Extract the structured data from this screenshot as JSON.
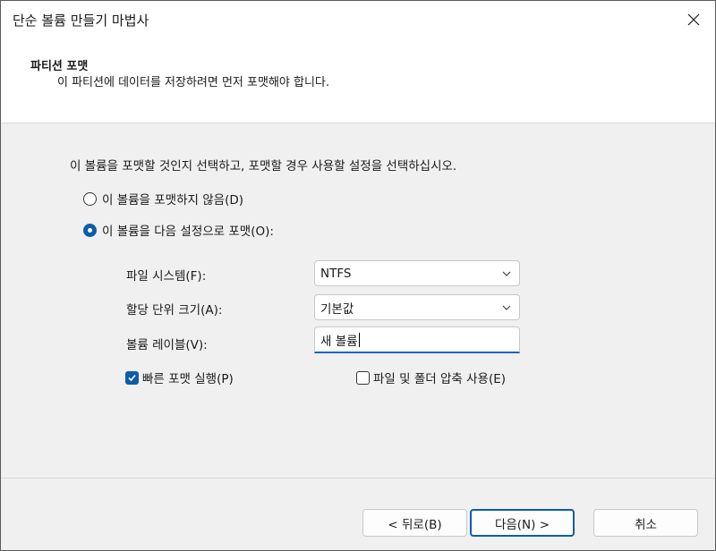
{
  "window": {
    "title": "단순 볼륨 만들기 마법사"
  },
  "header": {
    "title": "파티션 포맷",
    "subtitle": "이 파티션에 데이터를 저장하려면 먼저 포맷해야 합니다."
  },
  "body": {
    "instruction": "이 볼륨을 포맷할 것인지 선택하고, 포맷할 경우 사용할 설정을 선택하십시오.",
    "options": [
      {
        "label": "이 볼륨을 포맷하지 않음(D)",
        "checked": false
      },
      {
        "label": "이 볼륨을 다음 설정으로 포맷(O):",
        "checked": true
      }
    ],
    "fields": {
      "file_system": {
        "label": "파일 시스템(F):",
        "value": "NTFS"
      },
      "allocation_unit": {
        "label": "할당 단위 크기(A):",
        "value": "기본값"
      },
      "volume_label": {
        "label": "볼륨 레이블(V):",
        "value": "새 볼륨"
      }
    },
    "quick_format": {
      "label": "빠른 포맷 실행(P)",
      "checked": true
    },
    "compression": {
      "label": "파일 및 폴더 압축 사용(E)",
      "checked": false
    }
  },
  "footer": {
    "back_label": "< 뒤로(B)",
    "next_label": "다음(N) >",
    "cancel_label": "취소"
  },
  "colors": {
    "accent": "#0b5cad",
    "background": "#f0f0f0",
    "header_background": "#ffffff"
  }
}
